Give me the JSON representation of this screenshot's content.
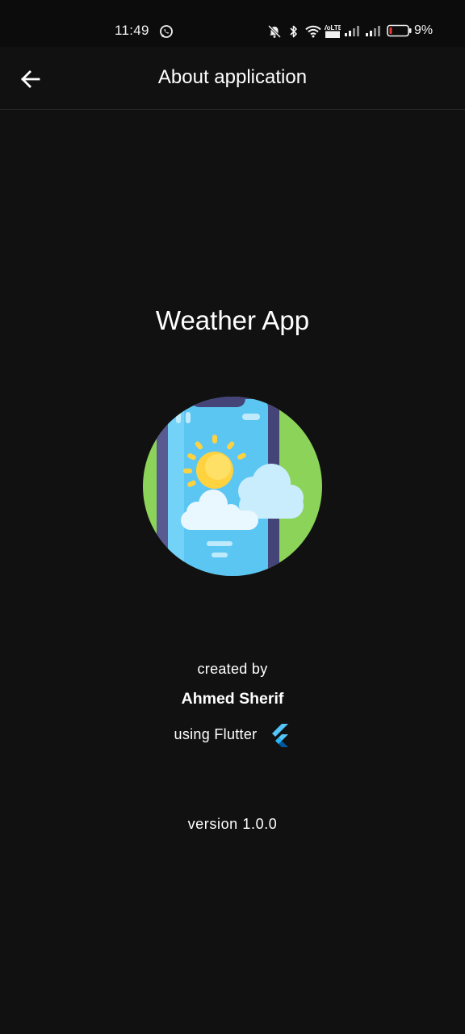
{
  "status_bar": {
    "time": "11:49",
    "battery": "9%",
    "icons": [
      "whatsapp-icon",
      "mute-icon",
      "bluetooth-icon",
      "wifi-icon",
      "volte-icon",
      "signal-icon",
      "signal-icon",
      "battery-icon"
    ]
  },
  "app_bar": {
    "title": "About application",
    "back_icon": "arrow-left-icon"
  },
  "main": {
    "app_name": "Weather App",
    "illustration": "weather-app-phone-icon",
    "created_by": "created by",
    "author": "Ahmed Sherif",
    "using": "using Flutter",
    "flutter_icon": "flutter-logo-icon",
    "version": "version 1.0.0"
  },
  "colors": {
    "background": "#111111",
    "text": "#ffffff",
    "illustration_green": "#8CD35A",
    "phone_frame": "#454479",
    "screen_blue": "#5CC6F3",
    "sun": "#FFD23F",
    "flutter_blue": "#42A5F5"
  },
  "volte_text": "VoLTE"
}
